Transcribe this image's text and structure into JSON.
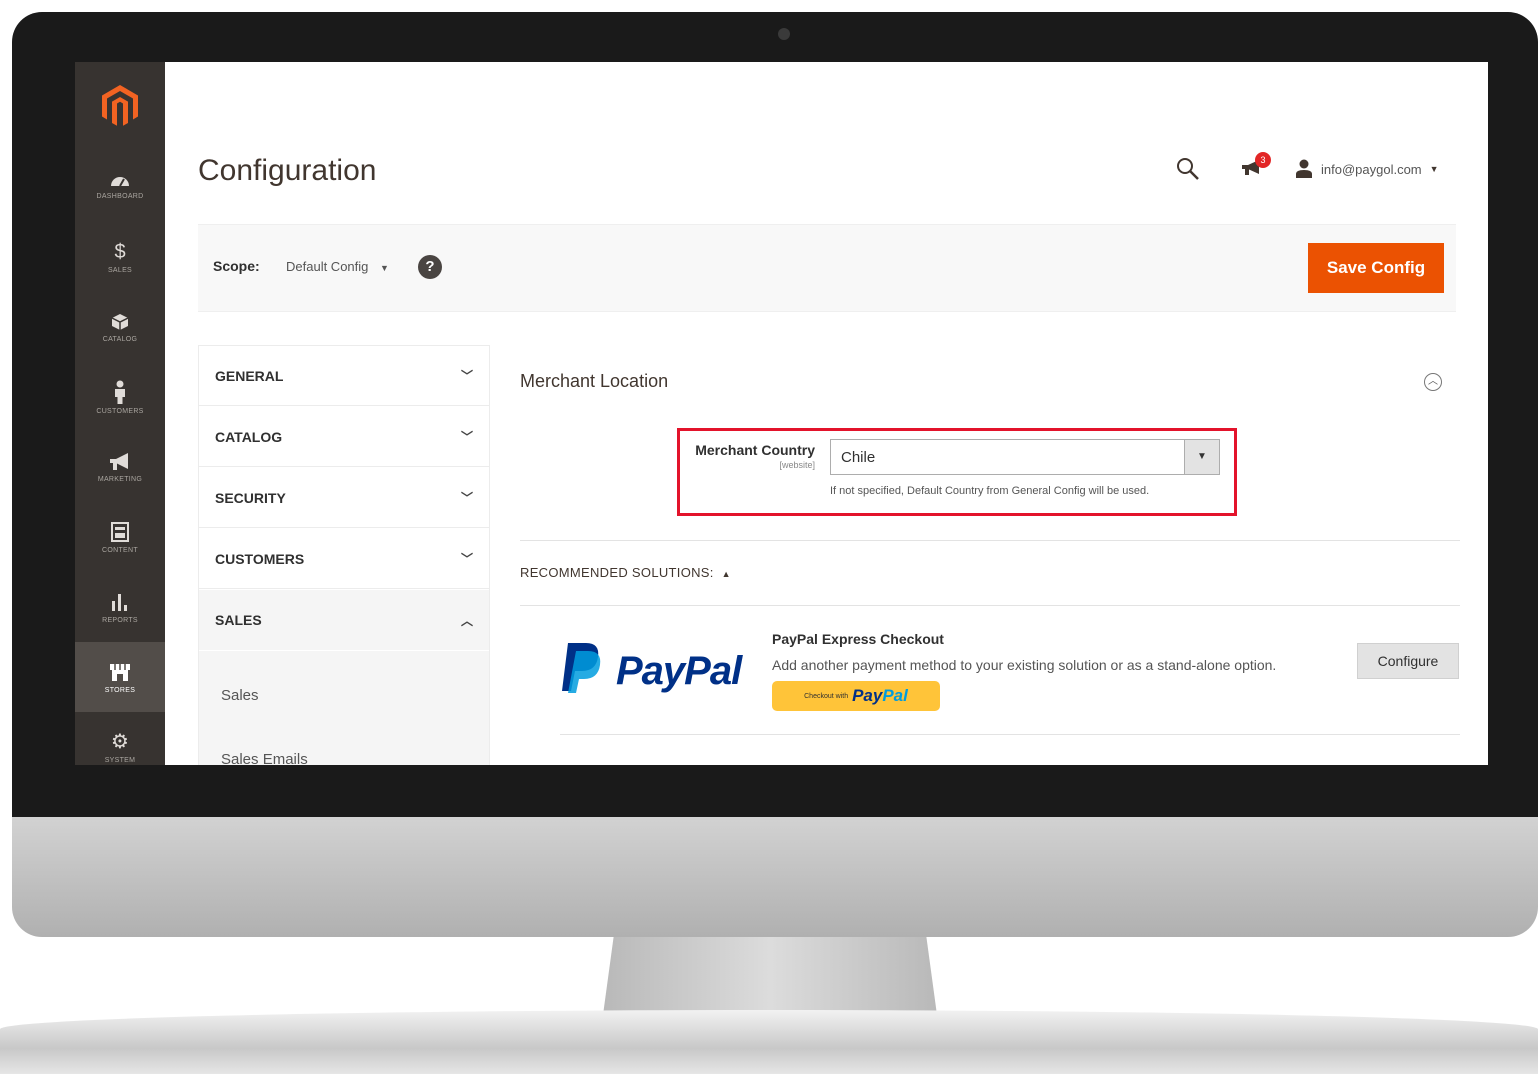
{
  "sidebar": {
    "items": [
      {
        "label": "DASHBOARD",
        "icon": "dashboard-icon"
      },
      {
        "label": "SALES",
        "icon": "dollar-icon"
      },
      {
        "label": "CATALOG",
        "icon": "cube-icon"
      },
      {
        "label": "CUSTOMERS",
        "icon": "person-icon"
      },
      {
        "label": "MARKETING",
        "icon": "megaphone-icon"
      },
      {
        "label": "CONTENT",
        "icon": "layout-icon"
      },
      {
        "label": "REPORTS",
        "icon": "bar-chart-icon"
      },
      {
        "label": "STORES",
        "icon": "store-icon"
      },
      {
        "label": "SYSTEM",
        "icon": "gear-icon"
      }
    ],
    "active": "STORES",
    "brand_color": "#eb5202"
  },
  "header": {
    "title": "Configuration",
    "notifications_count": "3",
    "user": "info@paygol.com"
  },
  "scope": {
    "label": "Scope:",
    "value": "Default Config",
    "save_label": "Save Config"
  },
  "config_nav": {
    "items": [
      "GENERAL",
      "CATALOG",
      "SECURITY",
      "CUSTOMERS",
      "SALES"
    ],
    "open": "SALES",
    "sub_items": [
      "Sales",
      "Sales Emails"
    ]
  },
  "section": {
    "title": "Merchant Location",
    "field_label": "Merchant Country",
    "field_scope": "[website]",
    "field_value": "Chile",
    "field_note": "If not specified, Default Country from General Config will be used.",
    "highlight_color": "#e3132b"
  },
  "recommended": {
    "label": "RECOMMENDED SOLUTIONS:",
    "paypal_logo": "PayPal",
    "title": "PayPal Express Checkout",
    "description": "Add another payment method to your existing solution or as a stand-alone option.",
    "badge_text": "Checkout with",
    "badge_pay": "Pay",
    "badge_pal": "Pal",
    "configure_label": "Configure"
  }
}
